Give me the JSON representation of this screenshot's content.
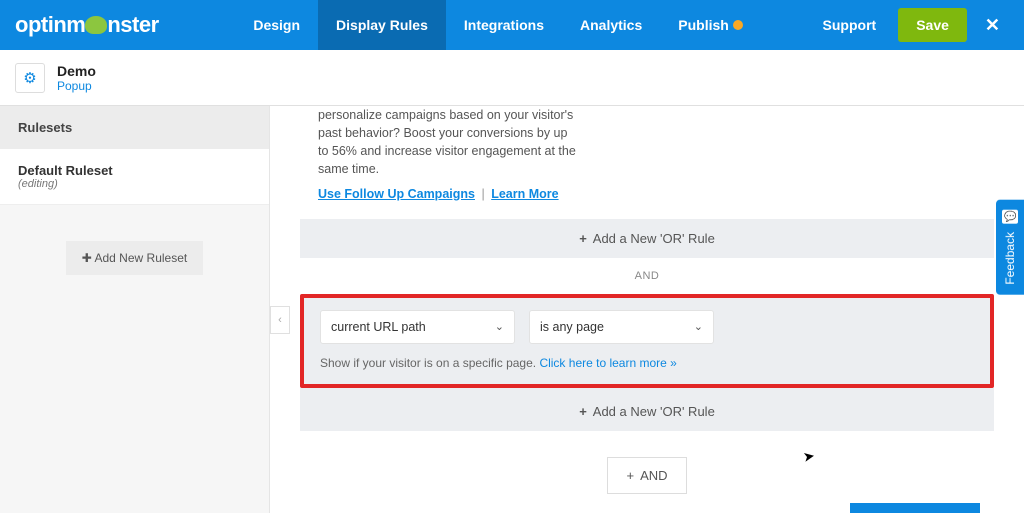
{
  "logo": {
    "prefix": "optinm",
    "suffix": "nster"
  },
  "nav": {
    "items": [
      "Design",
      "Display Rules",
      "Integrations",
      "Analytics",
      "Publish"
    ],
    "active_index": 1,
    "support": "Support",
    "save": "Save",
    "close": "✕"
  },
  "campaign": {
    "title": "Demo",
    "type": "Popup"
  },
  "sidebar": {
    "heading": "Rulesets",
    "ruleset": {
      "name": "Default Ruleset",
      "status": "(editing)"
    },
    "add_btn": "Add New Ruleset"
  },
  "promo": {
    "text": "personalize campaigns based on your visitor's past behavior? Boost your conversions by up to 56% and increase visitor engagement at the same time.",
    "link1": "Use Follow Up Campaigns",
    "sep": "|",
    "link2": "Learn More"
  },
  "or_rule_label": "Add a New 'OR' Rule",
  "and_label": "AND",
  "rule": {
    "condition": "current URL path",
    "operator": "is any page",
    "help_prefix": "Show if your visitor is on a specific page. ",
    "help_link": "Click here to learn more »"
  },
  "and_button": "AND",
  "feedback": "Feedback"
}
